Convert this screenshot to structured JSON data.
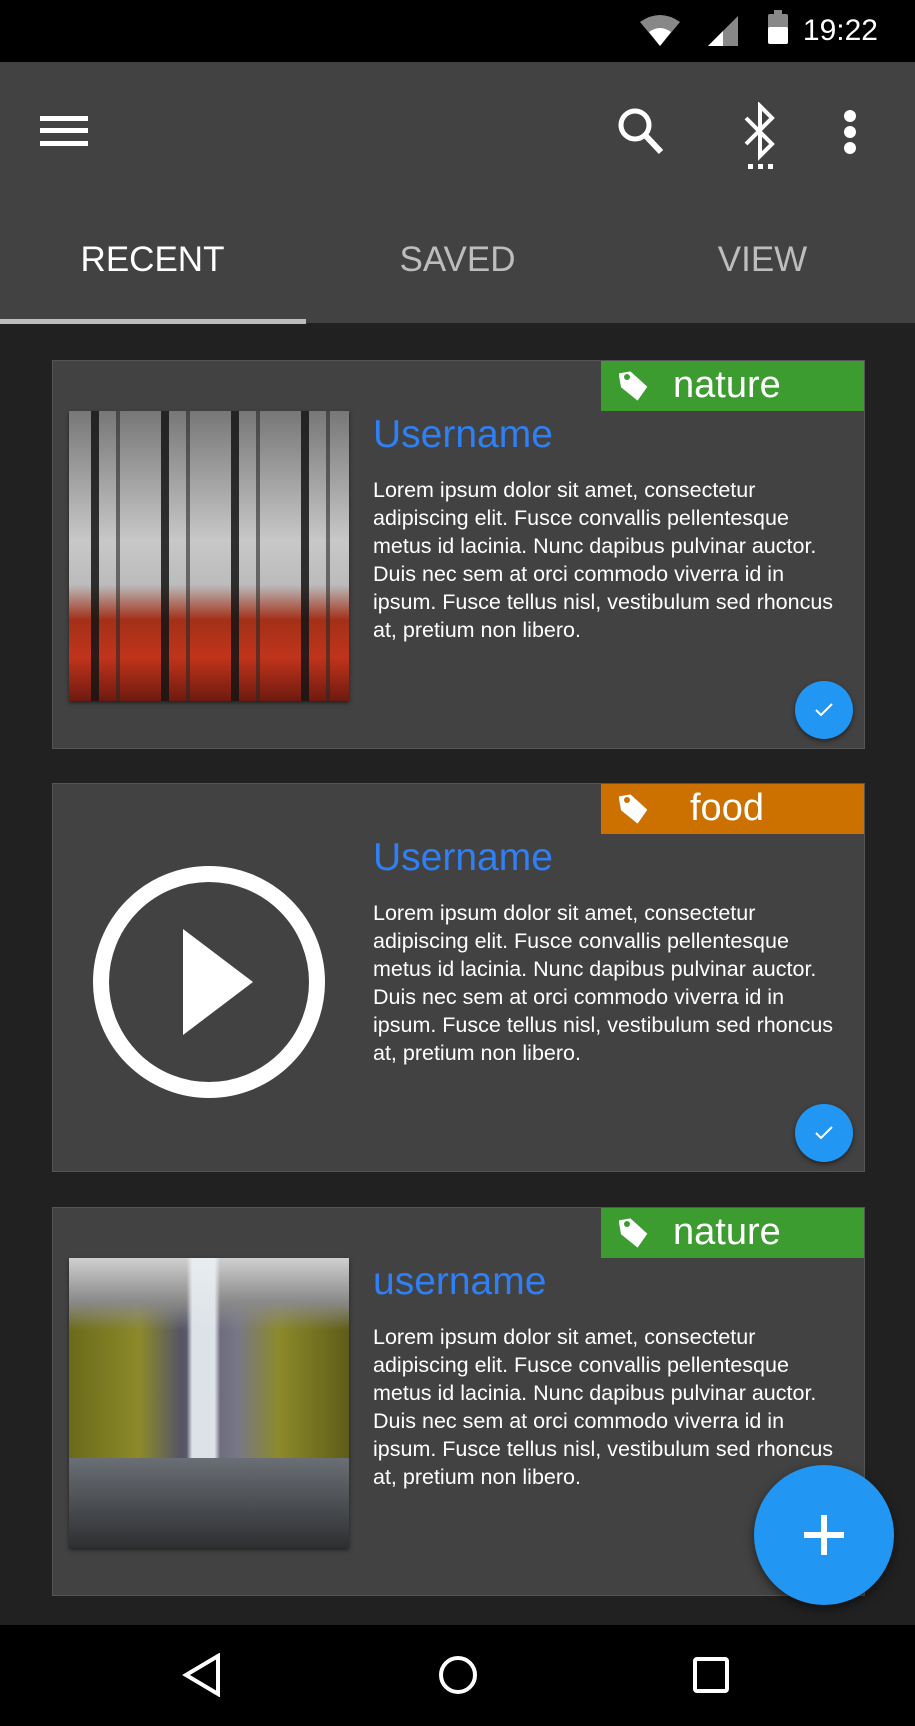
{
  "status_bar": {
    "time": "19:22",
    "icons": [
      "wifi-icon",
      "signal-icon",
      "battery-icon"
    ]
  },
  "app_bar": {
    "icons": [
      "menu-icon",
      "search-icon",
      "bluetooth-searching-icon",
      "more-vert-icon"
    ]
  },
  "tabs": [
    {
      "label": "RECENT",
      "active": true
    },
    {
      "label": "SAVED",
      "active": false
    },
    {
      "label": "VIEW",
      "active": false
    }
  ],
  "cards": [
    {
      "tag": "nature",
      "tag_color": "#3c9c30",
      "username": "Username",
      "media": "forest-image",
      "checked": true,
      "body": "Lorem ipsum dolor sit amet, consectetur adipiscing elit. Fusce convallis pellentesque metus id lacinia. Nunc dapibus pulvinar auctor. Duis nec sem at orci commodo viverra id in ipsum. Fusce tellus nisl, vestibulum sed rhoncus at, pretium non libero."
    },
    {
      "tag": "food",
      "tag_color": "#cc7000",
      "username": "Username",
      "media": "play-video-icon",
      "checked": true,
      "body": "Lorem ipsum dolor sit amet, consectetur adipiscing elit. Fusce convallis pellentesque metus id lacinia. Nunc dapibus pulvinar auctor. Duis nec sem at orci commodo viverra id in ipsum. Fusce tellus nisl, vestibulum sed rhoncus at, pretium non libero."
    },
    {
      "tag": "nature",
      "tag_color": "#3c9c30",
      "username": "username",
      "media": "waterfall-image",
      "body": "Lorem ipsum dolor sit amet, consectetur adipiscing elit. Fusce convallis pellentesque metus id lacinia. Nunc dapibus pulvinar auctor. Duis nec sem at orci commodo viverra id in ipsum. Fusce tellus nisl, vestibulum sed rhoncus at, pretium non libero."
    }
  ],
  "fab": {
    "icon": "plus-icon"
  },
  "colors": {
    "accent": "#2196f3",
    "username": "#2f7ff5",
    "appbar": "#424242",
    "background": "#212121"
  },
  "nav_bar": {
    "icons": [
      "back-icon",
      "home-icon",
      "recents-icon"
    ]
  }
}
